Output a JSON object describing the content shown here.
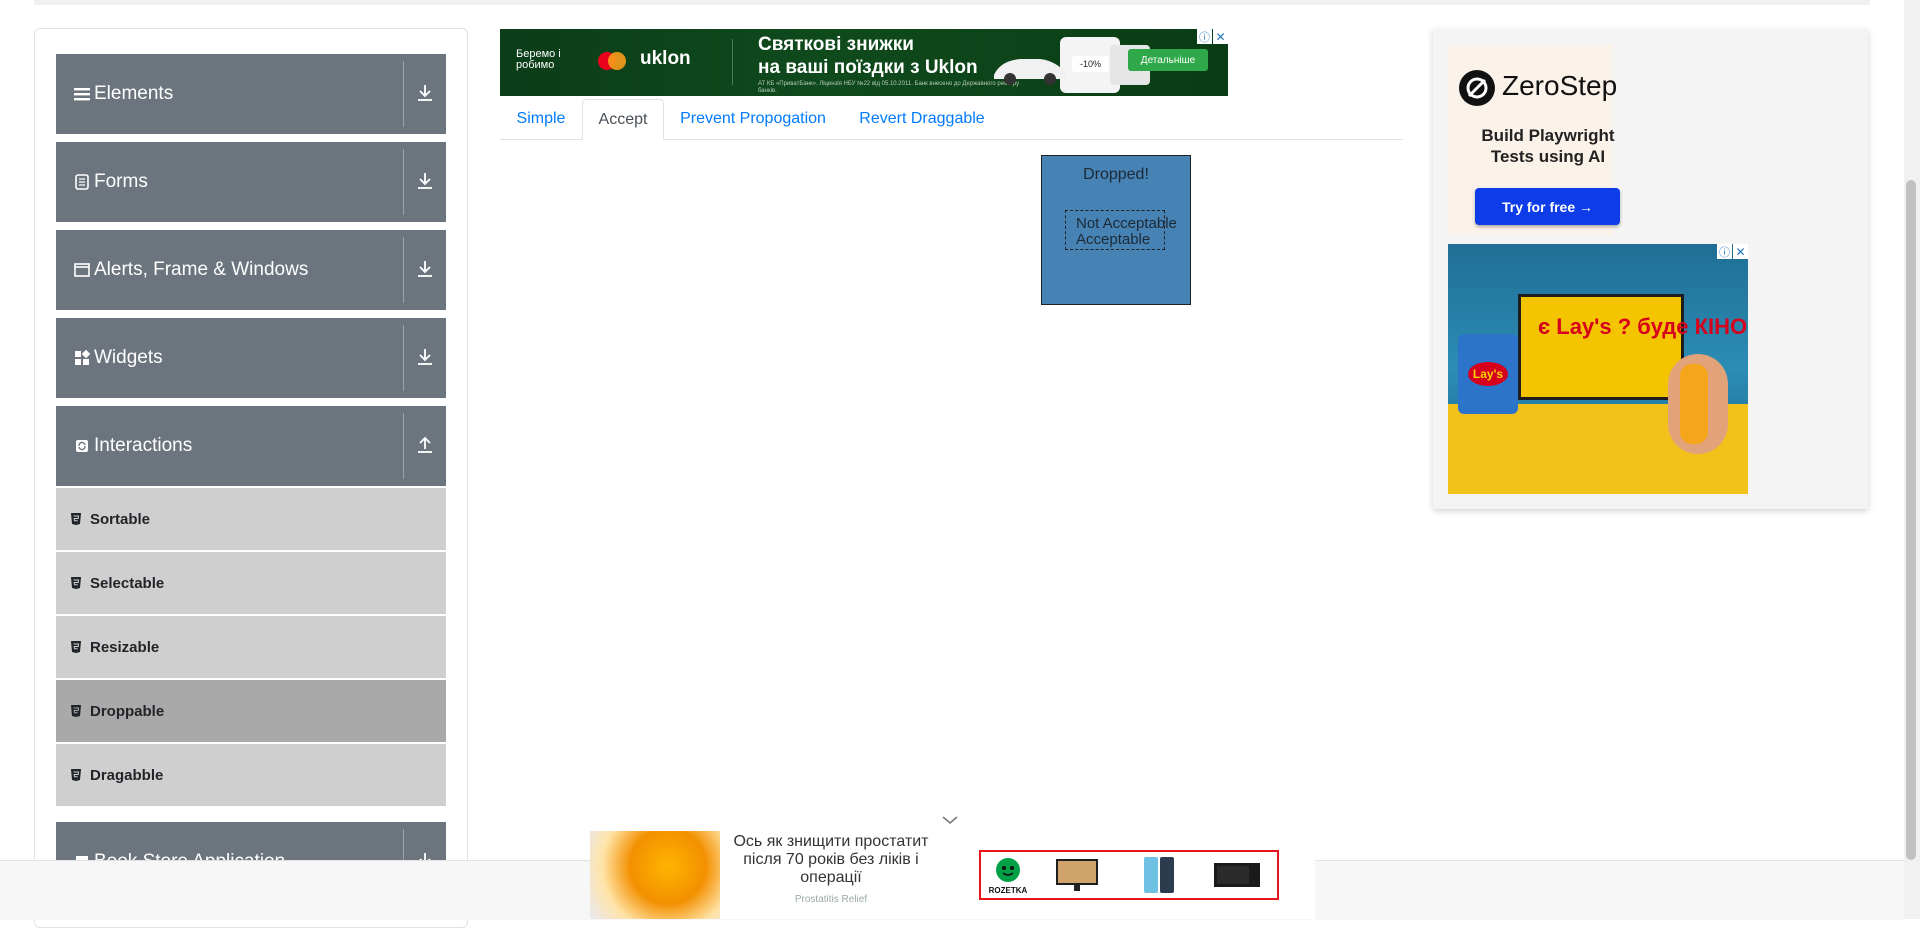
{
  "sidebar": {
    "groups": [
      {
        "label": "Elements",
        "icon": "list-icon",
        "state": "collapsed"
      },
      {
        "label": "Forms",
        "icon": "form-icon",
        "state": "collapsed"
      },
      {
        "label": "Alerts, Frame & Windows",
        "icon": "window-icon",
        "state": "collapsed"
      },
      {
        "label": "Widgets",
        "icon": "widgets-icon",
        "state": "collapsed"
      },
      {
        "label": "Interactions",
        "icon": "interactions-icon",
        "state": "expanded"
      },
      {
        "label": "Book Store Application",
        "icon": "book-icon",
        "state": "collapsed"
      }
    ],
    "interaction_items": [
      {
        "label": "Sortable"
      },
      {
        "label": "Selectable"
      },
      {
        "label": "Resizable"
      },
      {
        "label": "Droppable",
        "active": true
      },
      {
        "label": "Dragabble"
      }
    ]
  },
  "top_ad": {
    "brand": "Беремо і робимо",
    "partner": "uklon",
    "headline": "Святкові знижки\nна ваші поїздки з Uklon",
    "discount": "-10%",
    "cta": "Детальніше",
    "fine_print": "АТ КБ «ПриватБанк». Ліцензія НБУ №22 від 05.10.2011. Банк внесено до Державного реєстру банків."
  },
  "tabs": [
    {
      "label": "Simple",
      "active": false
    },
    {
      "label": "Accept",
      "active": true
    },
    {
      "label": "Prevent Propogation",
      "active": false
    },
    {
      "label": "Revert Draggable",
      "active": false
    }
  ],
  "drop_area": {
    "drop_text": "Dropped!",
    "not_acceptable": "Not Acceptable",
    "acceptable": "Acceptable"
  },
  "right_ads": {
    "zerostep": {
      "name": "ZeroStep",
      "subtitle": "Build Playwright\nTests using AI",
      "cta": "Try for free →"
    },
    "lays": {
      "headline": "є Lay's ? буде КІНО!",
      "logo": "Lay's"
    }
  },
  "bottom_ad": {
    "text": "Ось як знищити простатит після 70 років без ліків і операції",
    "source": "Prostatitis Relief",
    "rozetka_label": "ROZETKA"
  },
  "colors": {
    "sidebar_header": "#6c757d",
    "submenu": "#cfcfcf",
    "submenu_active": "#a9a9a9",
    "drop_box": "#4682b4",
    "link": "#007bff",
    "zerostep_button": "#0d3ce8",
    "rozetka_border": "#e8141b"
  }
}
